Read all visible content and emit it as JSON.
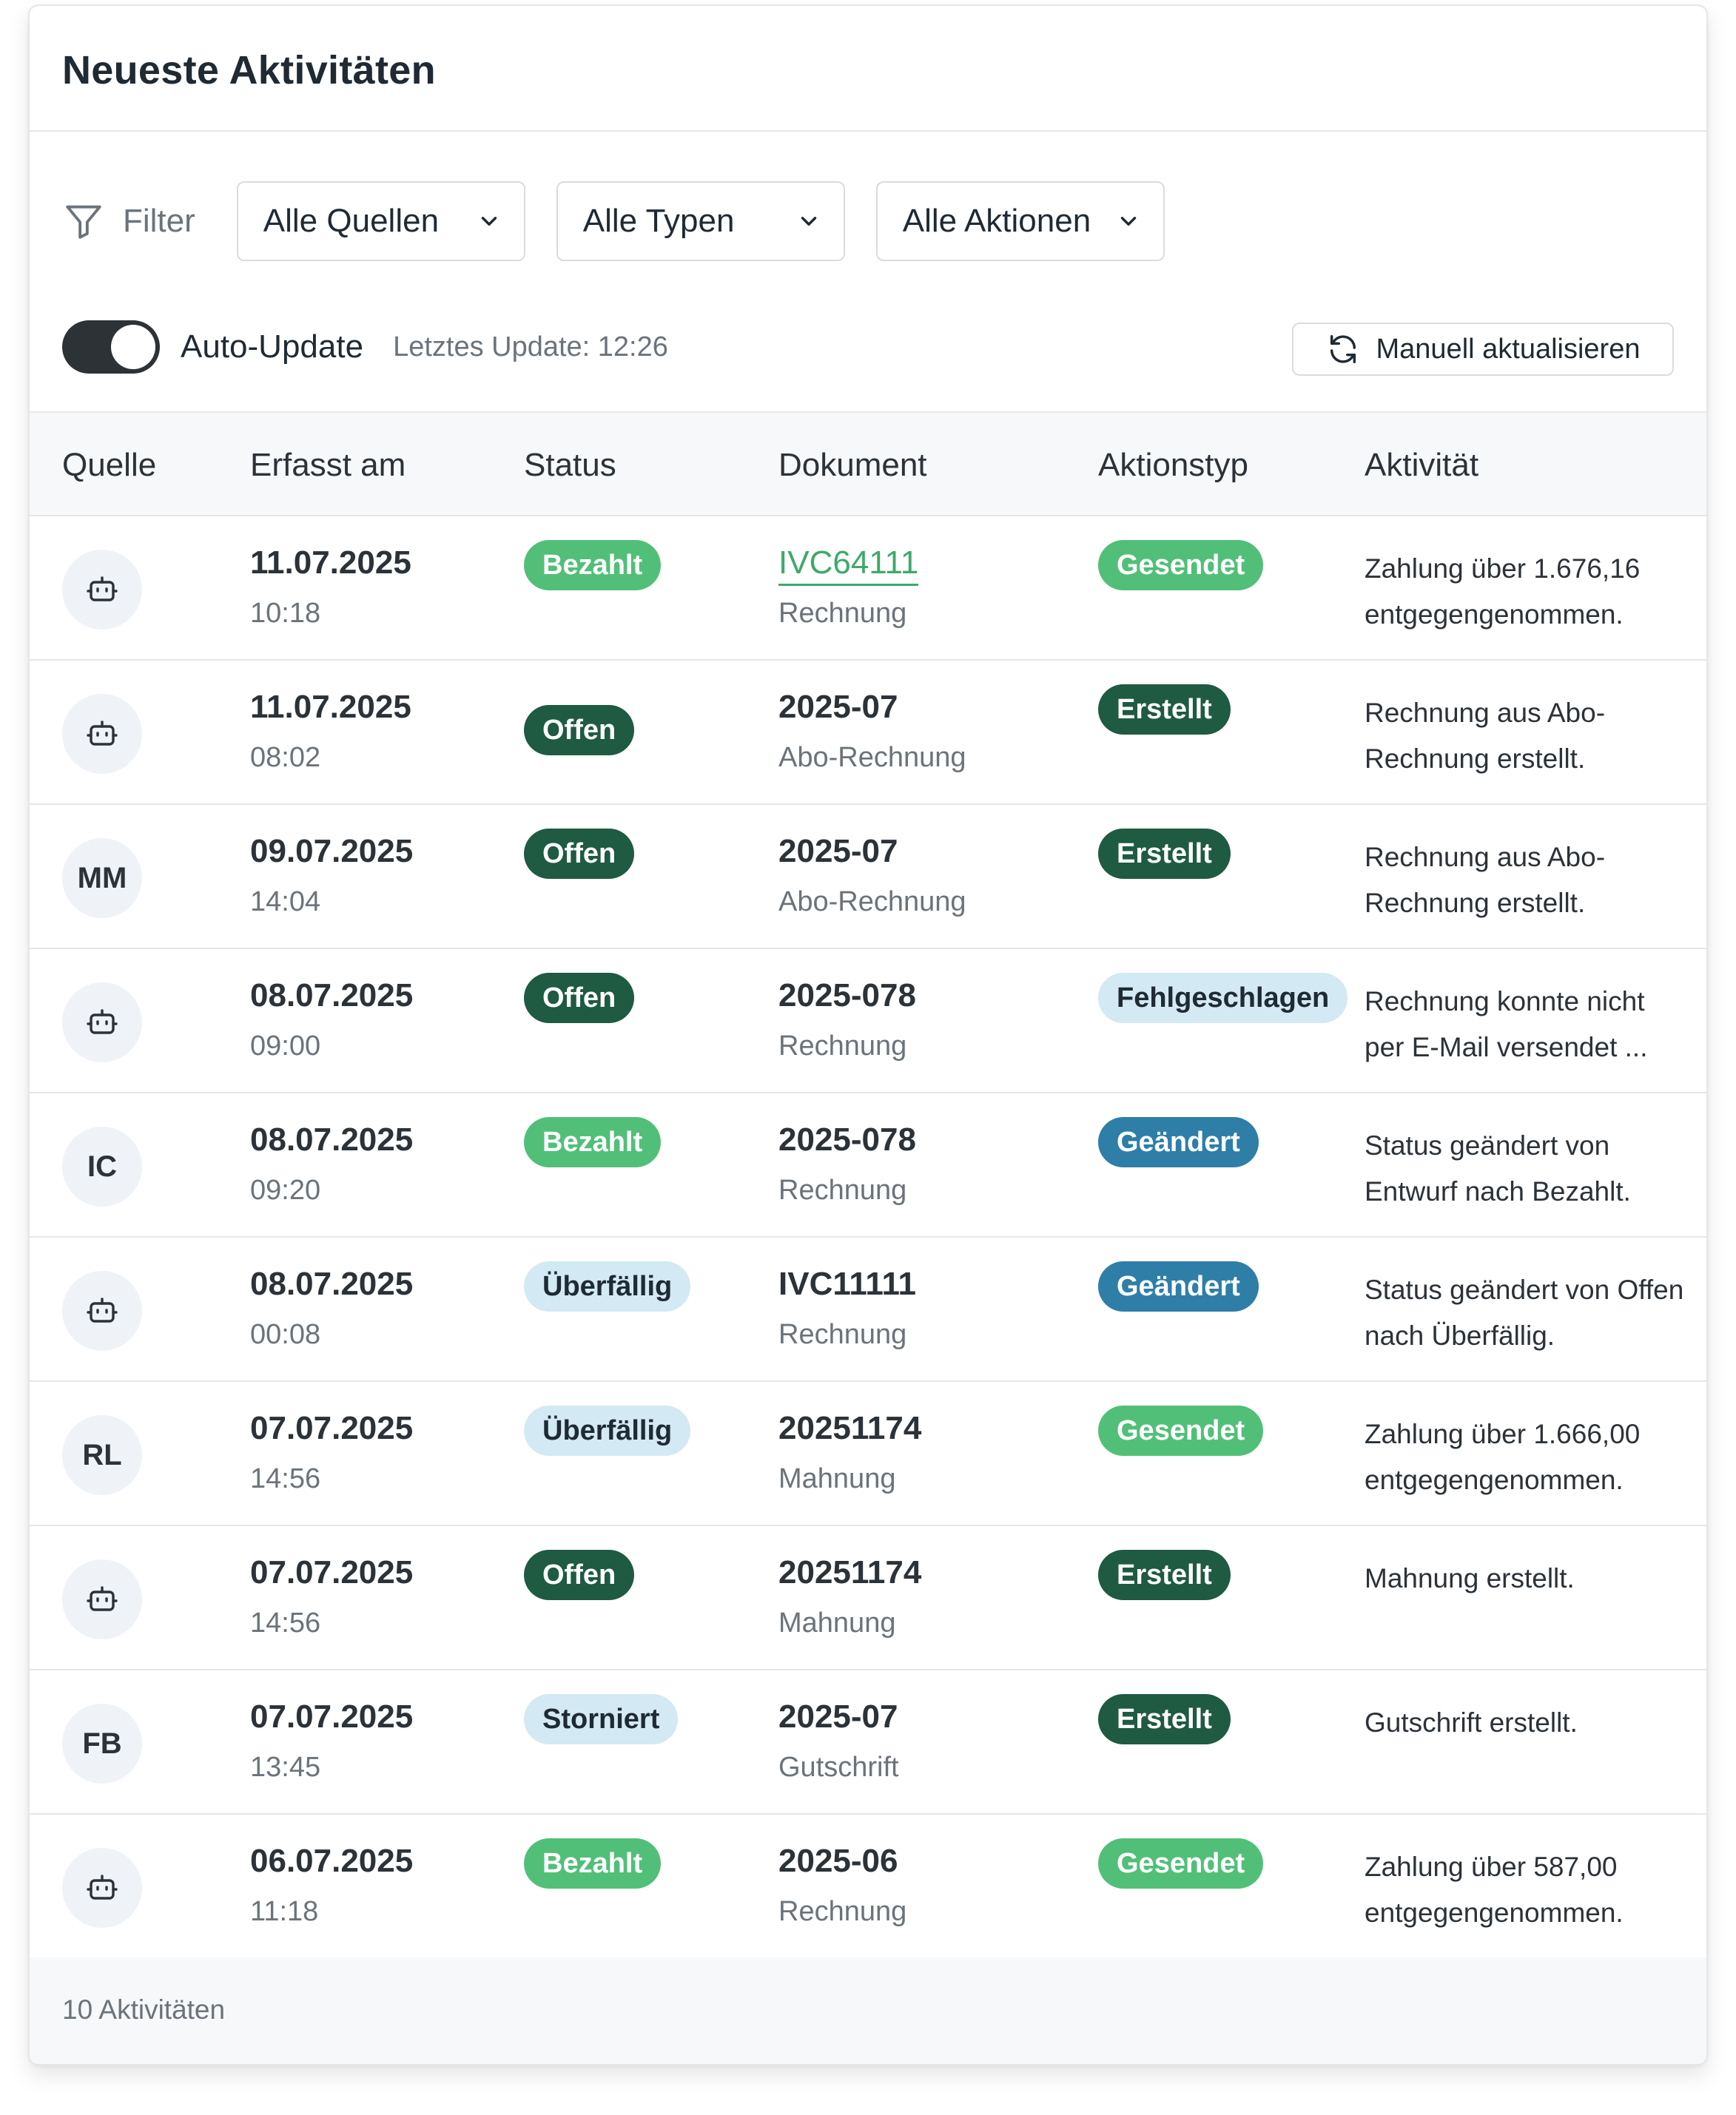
{
  "header": {
    "title": "Neueste Aktivitäten"
  },
  "filters": {
    "label": "Filter",
    "sources": "Alle Quellen",
    "types": "Alle Typen",
    "actions": "Alle Aktionen"
  },
  "auto_update": {
    "label": "Auto-Update",
    "enabled": true,
    "last_update": "Letztes Update: 12:26",
    "refresh_button": "Manuell aktualisieren"
  },
  "table": {
    "columns": [
      "Quelle",
      "Erfasst am",
      "Status",
      "Dokument",
      "Aktionstyp",
      "Aktivität"
    ],
    "rows": [
      {
        "source": "",
        "source_icon": "robot-icon",
        "date": "11.07.2025",
        "time": "10:18",
        "status": "Bezahlt",
        "status_style": "green",
        "doc": "IVC64111",
        "doc_link": true,
        "doc_type": "Rechnung",
        "action": "Gesendet",
        "action_style": "green",
        "activity": "Zahlung über 1.676,16 entgegengenommen."
      },
      {
        "source": "",
        "source_icon": "robot-icon",
        "date": "11.07.2025",
        "time": "08:02",
        "status": "Offen",
        "status_style": "dark",
        "doc": "2025-07",
        "doc_link": false,
        "doc_type": "Abo-Rechnung",
        "action": "Erstellt",
        "action_style": "dark",
        "activity": "Rechnung aus Abo-Rechnung erstellt."
      },
      {
        "source": "MM",
        "source_icon": "",
        "date": "09.07.2025",
        "time": "14:04",
        "status": "Offen",
        "status_style": "dark",
        "doc": "2025-07",
        "doc_link": false,
        "doc_type": "Abo-Rechnung",
        "action": "Erstellt",
        "action_style": "dark",
        "activity": "Rechnung aus Abo-Rechnung erstellt."
      },
      {
        "source": "",
        "source_icon": "robot-icon",
        "date": "08.07.2025",
        "time": "09:00",
        "status": "Offen",
        "status_style": "dark",
        "doc": "2025-078",
        "doc_link": false,
        "doc_type": "Rechnung",
        "action": "Fehlgeschlagen",
        "action_style": "light",
        "activity": "Rechnung konnte nicht per E-Mail versendet ..."
      },
      {
        "source": "IC",
        "source_icon": "",
        "date": "08.07.2025",
        "time": "09:20",
        "status": "Bezahlt",
        "status_style": "green",
        "doc": "2025-078",
        "doc_link": false,
        "doc_type": "Rechnung",
        "action": "Geändert",
        "action_style": "blue",
        "activity": "Status geändert von Entwurf nach Bezahlt."
      },
      {
        "source": "",
        "source_icon": "robot-icon",
        "date": "08.07.2025",
        "time": "00:08",
        "status": "Überfällig",
        "status_style": "light",
        "doc": "IVC11111",
        "doc_link": false,
        "doc_type": "Rechnung",
        "action": "Geändert",
        "action_style": "blue",
        "activity": "Status geändert von Offen nach Überfällig."
      },
      {
        "source": "RL",
        "source_icon": "",
        "date": "07.07.2025",
        "time": "14:56",
        "status": "Überfällig",
        "status_style": "light",
        "doc": "20251174",
        "doc_link": false,
        "doc_type": "Mahnung",
        "action": "Gesendet",
        "action_style": "green",
        "activity": "Zahlung über 1.666,00 entgegengenommen."
      },
      {
        "source": "",
        "source_icon": "robot-icon",
        "date": "07.07.2025",
        "time": "14:56",
        "status": "Offen",
        "status_style": "dark",
        "doc": "20251174",
        "doc_link": false,
        "doc_type": "Mahnung",
        "action": "Erstellt",
        "action_style": "dark",
        "activity": "Mahnung erstellt."
      },
      {
        "source": "FB",
        "source_icon": "",
        "date": "07.07.2025",
        "time": "13:45",
        "status": "Storniert",
        "status_style": "light",
        "doc": "2025-07",
        "doc_link": false,
        "doc_type": "Gutschrift",
        "action": "Erstellt",
        "action_style": "dark",
        "activity": "Gutschrift erstellt."
      },
      {
        "source": "",
        "source_icon": "robot-icon",
        "date": "06.07.2025",
        "time": "11:18",
        "status": "Bezahlt",
        "status_style": "green",
        "doc": "2025-06",
        "doc_link": false,
        "doc_type": "Rechnung",
        "action": "Gesendet",
        "action_style": "green",
        "activity": "Zahlung über 587,00 entgegengenommen."
      }
    ]
  },
  "footer": {
    "count": "10 Aktivitäten"
  },
  "colors": {
    "green": "#52bf79",
    "dark_green": "#1f5a43",
    "light_blue": "#d3e9f3",
    "blue": "#2e7ea8",
    "link": "#3daa6a"
  }
}
